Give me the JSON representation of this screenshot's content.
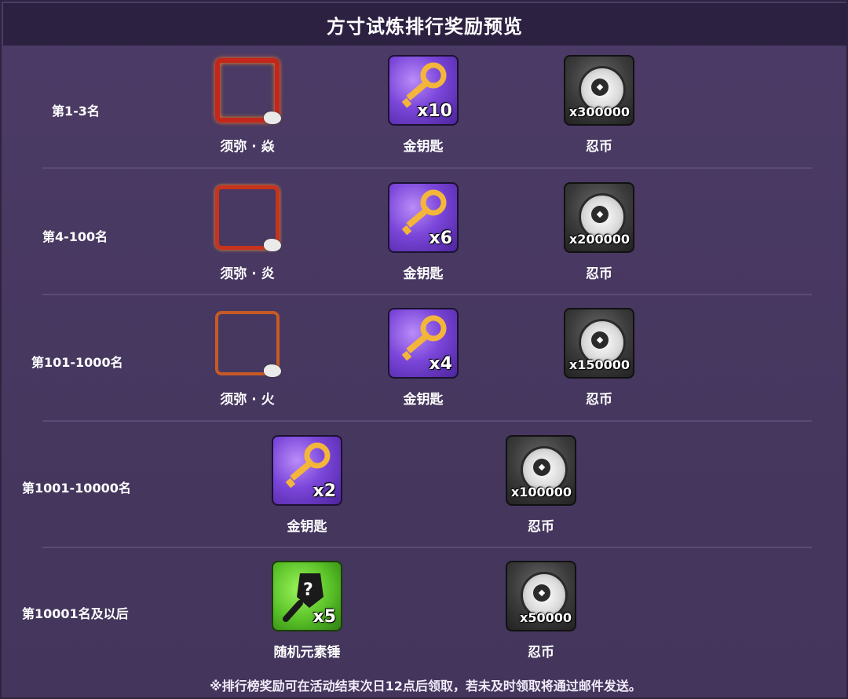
{
  "title": "方寸试炼排行奖励预览",
  "footer_note": "※排行榜奖励可在活动结束次日12点后领取，若未及时领取将通过邮件发送。",
  "tiers": [
    {
      "rank": "第1-3名",
      "frame_name": "须弥 · 焱",
      "key_qty": "x10",
      "key_name": "金钥匙",
      "coin_qty": "x300000",
      "coin_name": "忍币"
    },
    {
      "rank": "第4-100名",
      "frame_name": "须弥 · 炎",
      "key_qty": "x6",
      "key_name": "金钥匙",
      "coin_qty": "x200000",
      "coin_name": "忍币"
    },
    {
      "rank": "第101-1000名",
      "frame_name": "须弥 · 火",
      "key_qty": "x4",
      "key_name": "金钥匙",
      "coin_qty": "x150000",
      "coin_name": "忍币"
    },
    {
      "rank": "第1001-10000名",
      "key_qty": "x2",
      "key_name": "金钥匙",
      "coin_qty": "x100000",
      "coin_name": "忍币"
    },
    {
      "rank": "第10001名及以后",
      "hammer_qty": "x5",
      "hammer_name": "随机元素锤",
      "coin_qty": "x50000",
      "coin_name": "忍币"
    }
  ],
  "colors": {
    "panel_bg": "#4a3a63",
    "title_bar": "#2d2142",
    "separator": "#5a4b76",
    "key_purple": "#7b46da",
    "hammer_green": "#58c027"
  },
  "icons": [
    "avatar-frame-icon",
    "gold-key-icon",
    "ninja-coin-icon",
    "element-hammer-icon"
  ]
}
